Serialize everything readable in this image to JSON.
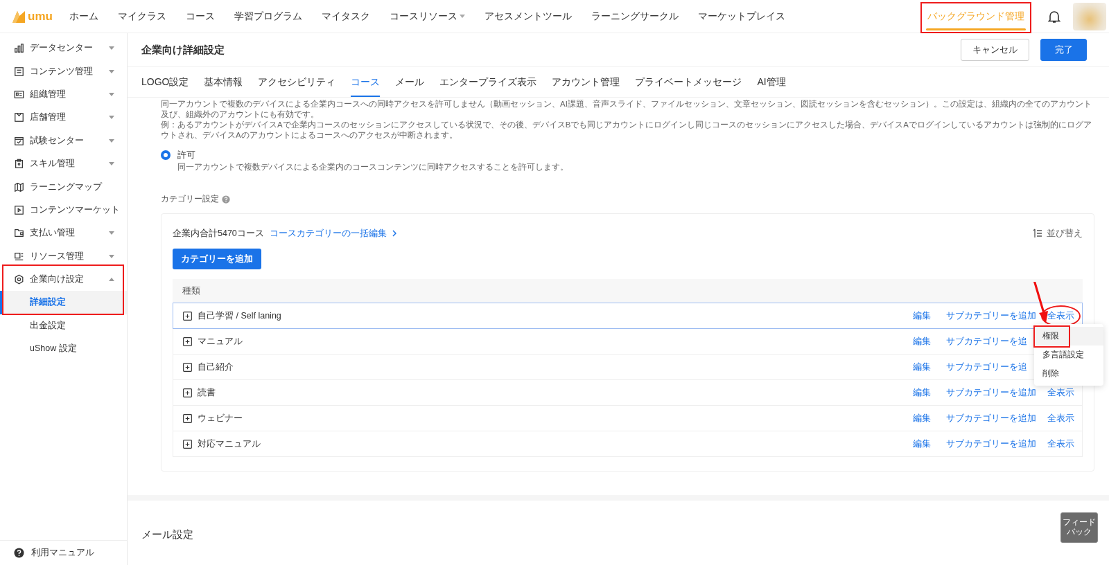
{
  "logo": {
    "text": "umu"
  },
  "nav": [
    {
      "label": "ホーム",
      "selected": false,
      "dropdown": false,
      "marked": false
    },
    {
      "label": "マイクラス",
      "selected": false,
      "dropdown": false,
      "marked": false
    },
    {
      "label": "コース",
      "selected": false,
      "dropdown": false,
      "marked": false
    },
    {
      "label": "学習プログラム",
      "selected": false,
      "dropdown": false,
      "marked": false
    },
    {
      "label": "マイタスク",
      "selected": false,
      "dropdown": false,
      "marked": false
    },
    {
      "label": "コースリソース",
      "selected": false,
      "dropdown": true,
      "marked": false
    },
    {
      "label": "アセスメントツール",
      "selected": false,
      "dropdown": false,
      "marked": false
    },
    {
      "label": "ラーニングサークル",
      "selected": false,
      "dropdown": false,
      "marked": false
    },
    {
      "label": "マーケットプレイス",
      "selected": false,
      "dropdown": false,
      "marked": false
    }
  ],
  "admin_nav": {
    "label": "バックグラウンド管理",
    "selected": true,
    "marked": true
  },
  "sidebar": {
    "items": [
      {
        "label": "データセンター",
        "kind": "group",
        "expanded": false,
        "marked": false
      },
      {
        "label": "コンテンツ管理",
        "kind": "group",
        "expanded": false,
        "marked": false
      },
      {
        "label": "組織管理",
        "kind": "group",
        "expanded": false,
        "marked": false
      },
      {
        "label": "店舗管理",
        "kind": "group",
        "expanded": false,
        "marked": false
      },
      {
        "label": "試験センター",
        "kind": "group",
        "expanded": false,
        "marked": false
      },
      {
        "label": "スキル管理",
        "kind": "group",
        "expanded": false,
        "marked": false
      },
      {
        "label": "ラーニングマップ",
        "kind": "link",
        "marked": false
      },
      {
        "label": "コンテンツマーケット",
        "kind": "link",
        "marked": false
      },
      {
        "label": "支払い管理",
        "kind": "group",
        "expanded": false,
        "marked": false
      },
      {
        "label": "リソース管理",
        "kind": "group",
        "expanded": false,
        "marked": false
      },
      {
        "label": "企業向け設定",
        "kind": "group",
        "expanded": true,
        "marked": true,
        "children": [
          {
            "label": "詳細設定",
            "selected": true
          },
          {
            "label": "出金設定",
            "selected": false
          },
          {
            "label": "uShow 設定",
            "selected": false
          }
        ]
      }
    ],
    "footer": "利用マニュアル"
  },
  "header": {
    "title": "企業向け詳細設定",
    "buttons": [
      {
        "label": "キャンセル",
        "kind": "secondary"
      },
      {
        "label": "完了",
        "kind": "primary"
      }
    ]
  },
  "tabs": [
    {
      "label": "LOGO設定",
      "selected": false
    },
    {
      "label": "基本情報",
      "selected": false
    },
    {
      "label": "アクセシビリティ",
      "selected": false
    },
    {
      "label": "コース",
      "selected": true
    },
    {
      "label": "メール",
      "selected": false
    },
    {
      "label": "エンタープライズ表示",
      "selected": false
    },
    {
      "label": "アカウント管理",
      "selected": false
    },
    {
      "label": "プライベートメッセージ",
      "selected": false
    },
    {
      "label": "AI管理",
      "selected": false
    }
  ],
  "access_note": [
    "同一アカウントで複数のデバイスによる企業内コースへの同時アクセスを許可しません（動画セッション、AI課題、音声スライド、ファイルセッション、文章セッション、図読セッションを含むセッション）。この設定は、組織内の全てのアカウント及び、組織外のアカウントにも有効です。",
    "例：あるアカウントがデバイスAで企業内コースのセッションにアクセスしている状況で、その後、デバイスBでも同じアカウントにログインし同じコースのセッションにアクセスした場合、デバイスAでログインしているアカウントは強制的にログアウトされ、デバイスAのアカウントによるコースへのアクセスが中断されます。"
  ],
  "access_option": {
    "label": "許可",
    "description": "同一アカウントで複数デバイスによる企業内のコースコンテンツに同時アクセスすることを許可します。",
    "selected": true
  },
  "category": {
    "title": "カテゴリー設定",
    "summary": "企業内合計5470コース",
    "bulk_edit_link": "コースカテゴリーの一括編集",
    "sort": "並び替え",
    "add_button": "カテゴリーを追加",
    "column": "種類",
    "rows": [
      {
        "name": "自己学習 / Self laning",
        "highlighted": true,
        "actions": [
          {
            "label": "編集",
            "marked": false
          },
          {
            "label": "サブカテゴリーを追加",
            "marked": false
          },
          {
            "label": "全表示",
            "marked": true
          }
        ],
        "menu": [
          {
            "label": "権限",
            "hovered": true,
            "marked": true
          },
          {
            "label": "多言語設定",
            "hovered": false,
            "marked": false
          },
          {
            "label": "削除",
            "hovered": false,
            "marked": false
          }
        ]
      },
      {
        "name": "マニュアル",
        "highlighted": false,
        "actions": [
          {
            "label": "編集",
            "marked": false
          },
          {
            "label": "サブカテゴリーを追",
            "marked": false
          }
        ]
      },
      {
        "name": "自己紹介",
        "highlighted": false,
        "actions": [
          {
            "label": "編集",
            "marked": false
          },
          {
            "label": "サブカテゴリーを追",
            "marked": false
          }
        ]
      },
      {
        "name": "読書",
        "highlighted": false,
        "actions": [
          {
            "label": "編集",
            "marked": false
          },
          {
            "label": "サブカテゴリーを追加",
            "marked": false
          },
          {
            "label": "全表示",
            "marked": false
          }
        ]
      },
      {
        "name": "ウェビナー",
        "highlighted": false,
        "actions": [
          {
            "label": "編集",
            "marked": false
          },
          {
            "label": "サブカテゴリーを追加",
            "marked": false
          },
          {
            "label": "全表示",
            "marked": false
          }
        ]
      },
      {
        "name": "対応マニュアル",
        "highlighted": false,
        "actions": [
          {
            "label": "編集",
            "marked": false
          },
          {
            "label": "サブカテゴリーを追加",
            "marked": false
          },
          {
            "label": "全表示",
            "marked": false
          }
        ]
      }
    ]
  },
  "mail_section": {
    "title": "メール設定"
  },
  "feedback": "フィードバック"
}
